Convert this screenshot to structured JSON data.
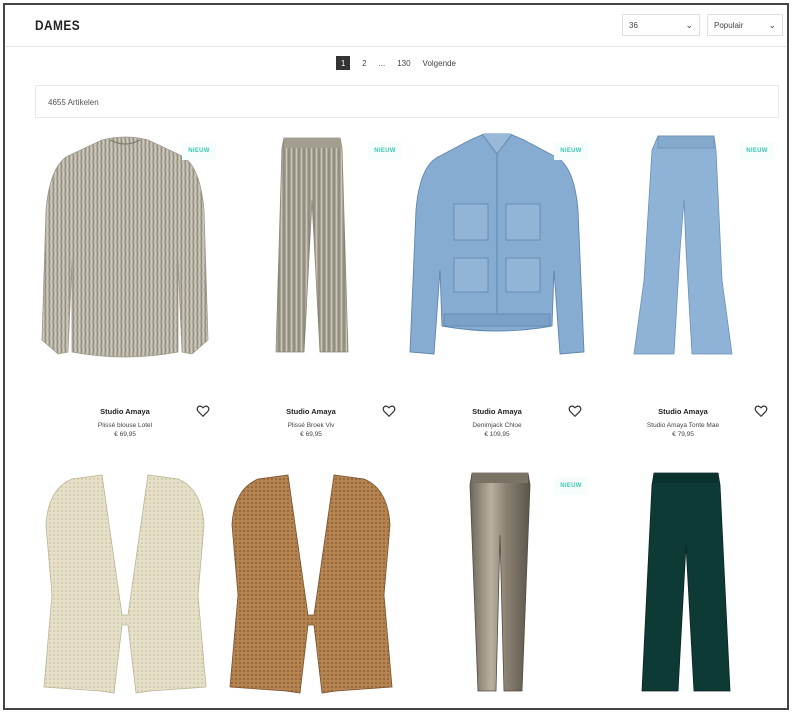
{
  "page": {
    "title": "DAMES",
    "size_select": "36",
    "sort_select": "Populair",
    "pagination": {
      "current": "1",
      "page2": "2",
      "ellipsis": "...",
      "last": "130",
      "next": "Volgende"
    },
    "article_count": "4655 Artikelen"
  },
  "badge_label": "NIEUW",
  "products": [
    {
      "brand": "Studio Amaya",
      "name": "Plissé blouse Lotel",
      "price": "€ 69,95",
      "new": true
    },
    {
      "brand": "Studio Amaya",
      "name": "Plissé Broek Viv",
      "price": "€ 69,95",
      "new": true
    },
    {
      "brand": "Studio Amaya",
      "name": "Denimjack Chloe",
      "price": "€ 109,95",
      "new": true
    },
    {
      "brand": "Studio Amaya",
      "name": "Studio Amaya Tonte Mae",
      "price": "€ 79,95",
      "new": true
    },
    {
      "new": false
    },
    {
      "new": false
    },
    {
      "new": true
    },
    {
      "new": false
    }
  ],
  "colors": {
    "accent_badge": "#3cc7b1",
    "pager_active": "#333333"
  }
}
